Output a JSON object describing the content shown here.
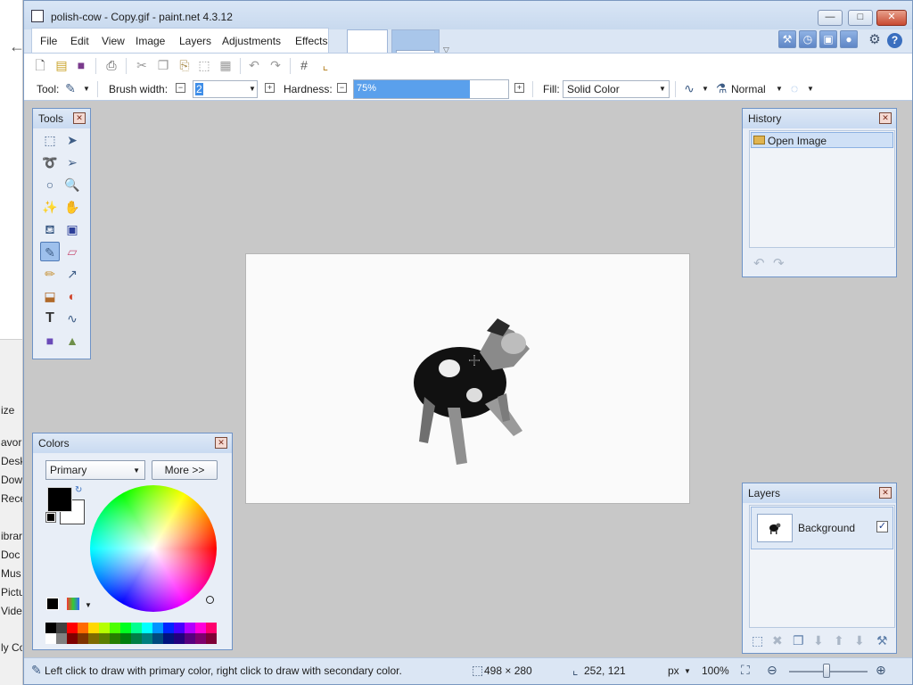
{
  "background_window": {
    "items": [
      "ize",
      "avori",
      "Desk",
      "Dow",
      "Rece",
      "ibrari",
      "Doc",
      "Mus",
      "Pictu",
      "Vide",
      "ly Co"
    ]
  },
  "window": {
    "title": "polish-cow - Copy.gif - paint.net 4.3.12",
    "controls": {
      "minimize": "—",
      "maximize": "□",
      "close": "✕"
    }
  },
  "menu": [
    "File",
    "Edit",
    "View",
    "Image",
    "Layers",
    "Adjustments",
    "Effects"
  ],
  "utility_icons": [
    "tools-window-icon",
    "history-window-icon",
    "layers-window-icon",
    "colors-window-icon",
    "settings-gear-icon",
    "help-icon"
  ],
  "toolbar": {
    "icons": [
      "new-icon",
      "open-icon",
      "save-icon",
      "print-icon",
      "cut-icon",
      "copy-icon",
      "paste-icon",
      "crop-icon",
      "deselect-icon",
      "undo-icon",
      "redo-icon",
      "grid-icon",
      "ruler-icon"
    ]
  },
  "tool_settings": {
    "tool_label": "Tool:",
    "brush_width_label": "Brush width:",
    "brush_width_value": "2",
    "hardness_label": "Hardness:",
    "hardness_value": "75%",
    "hardness_fraction": 0.75,
    "fill_label": "Fill:",
    "fill_value": "Solid Color",
    "blend_mode": "Normal"
  },
  "tools": [
    "rectangle-select",
    "move-selected",
    "lasso-select",
    "move-selection",
    "ellipse-select",
    "zoom",
    "magic-wand",
    "pan",
    "paint-bucket",
    "gradient",
    "paintbrush",
    "eraser",
    "pencil",
    "color-picker",
    "clone-stamp",
    "recolor",
    "text",
    "line-curve",
    "shapes"
  ],
  "active_tool": "paintbrush",
  "history": {
    "title": "History",
    "items": [
      "Open Image"
    ]
  },
  "colors": {
    "title": "Colors",
    "mode": "Primary",
    "more_label": "More >>",
    "primary": "#000000",
    "secondary": "#ffffff",
    "palette": [
      "#000000",
      "#404040",
      "#ff0000",
      "#ff6a00",
      "#ffd800",
      "#b6ff00",
      "#4cff00",
      "#00ff21",
      "#00ff90",
      "#00ffff",
      "#0094ff",
      "#0026ff",
      "#4800ff",
      "#b200ff",
      "#ff00dc",
      "#ff006e",
      "#ffffff",
      "#808080",
      "#7f0000",
      "#7f3300",
      "#7f6a00",
      "#5b7f00",
      "#267f00",
      "#007f0e",
      "#007f46",
      "#007f7f",
      "#004a7f",
      "#00137f",
      "#21007f",
      "#57007f",
      "#7f006e",
      "#7f0037"
    ]
  },
  "layers": {
    "title": "Layers",
    "items": [
      {
        "name": "Background",
        "visible": "✓"
      }
    ]
  },
  "status": {
    "hint": "Left click to draw with primary color, right click to draw with secondary color.",
    "image_size": "498 × 280",
    "cursor_pos": "252, 121",
    "unit": "px",
    "zoom": "100%"
  }
}
